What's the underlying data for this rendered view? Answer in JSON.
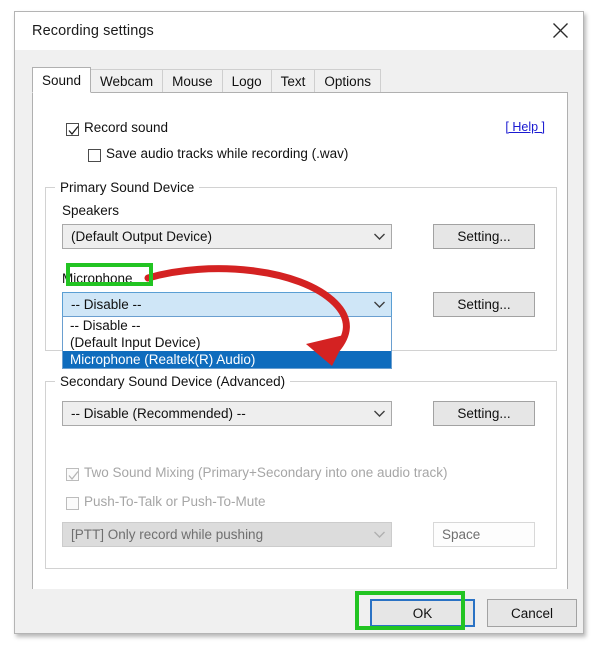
{
  "window": {
    "title": "Recording settings",
    "close_icon": "close-icon"
  },
  "tabs": [
    {
      "label": "Sound",
      "active": true
    },
    {
      "label": "Webcam",
      "active": false
    },
    {
      "label": "Mouse",
      "active": false
    },
    {
      "label": "Logo",
      "active": false
    },
    {
      "label": "Text",
      "active": false
    },
    {
      "label": "Options",
      "active": false
    }
  ],
  "sound_tab": {
    "record_sound": {
      "label": "Record sound",
      "checked": true
    },
    "save_audio_tracks": {
      "label": "Save audio tracks while recording (.wav)",
      "checked": false
    },
    "help_link": "[ Help ]",
    "primary_group": {
      "title": "Primary Sound Device",
      "speakers": {
        "label": "Speakers",
        "value": "(Default Output Device)",
        "setting_button": "Setting..."
      },
      "microphone": {
        "label": "Microphone",
        "value": "-- Disable --",
        "setting_button": "Setting...",
        "expanded": true,
        "options": [
          {
            "label": "-- Disable --",
            "selected": false
          },
          {
            "label": "(Default Input Device)",
            "selected": false
          },
          {
            "label": "Microphone (Realtek(R) Audio)",
            "selected": true
          }
        ]
      }
    },
    "secondary_group": {
      "title": "Secondary Sound Device (Advanced)",
      "device": {
        "value": "-- Disable (Recommended) --",
        "setting_button": "Setting..."
      },
      "two_sound_mixing": {
        "label": "Two Sound Mixing (Primary+Secondary into one audio track)",
        "checked": true,
        "disabled": true
      },
      "push_to_talk": {
        "label": "Push-To-Talk or Push-To-Mute",
        "checked": false,
        "disabled": true
      },
      "ptt_mode": {
        "value": "[PTT] Only record while pushing",
        "disabled": true
      },
      "ptt_key": {
        "value": "Space",
        "disabled": true
      }
    }
  },
  "footer": {
    "ok_button": "OK",
    "cancel_button": "Cancel"
  },
  "annotations": {
    "highlight_color": "#22c422",
    "arrow_color": "#d42222",
    "selection_color": "#0f6cbd"
  }
}
